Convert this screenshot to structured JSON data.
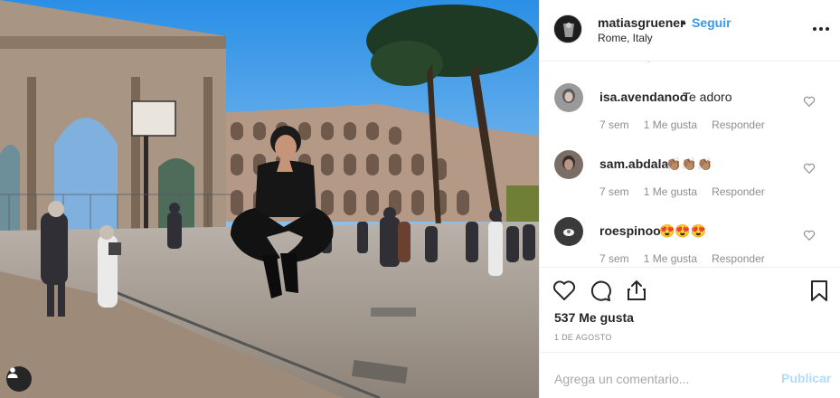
{
  "post": {
    "image_alt": "",
    "tag_icon": "person-icon"
  },
  "header": {
    "username": "matiasgruener",
    "separator": "•",
    "follow_label": "Seguir",
    "location": "Rome, Italy",
    "more_icon": "more-options-icon"
  },
  "comments": [
    {
      "username": "isa.avendanoo",
      "text": "Te adoro",
      "time": "7 sem",
      "likes": "1 Me gusta",
      "reply": "Responder",
      "avatar_color": "#8a8a8a"
    },
    {
      "username": "sam.abdala",
      "text": "👏🏽👏🏽👏🏽",
      "time": "7 sem",
      "likes": "1 Me gusta",
      "reply": "Responder",
      "avatar_color": "#6b6b6b"
    },
    {
      "username": "roespinoo",
      "text": "😍😍😍",
      "time": "7 sem",
      "likes": "1 Me gusta",
      "reply": "Responder",
      "avatar_color": "#3a3a3a"
    }
  ],
  "actions": {
    "like_icon": "heart-icon",
    "comment_icon": "comment-icon",
    "share_icon": "share-icon",
    "save_icon": "bookmark-icon",
    "likes_text": "537 Me gusta",
    "date": "1 DE AGOSTO"
  },
  "composer": {
    "placeholder": "Agrega un comentario...",
    "publish_label": "Publicar"
  },
  "colors": {
    "link": "#3897f0",
    "publish_disabled": "#b3dbff",
    "muted": "#8e8e8e",
    "text": "#262626"
  }
}
